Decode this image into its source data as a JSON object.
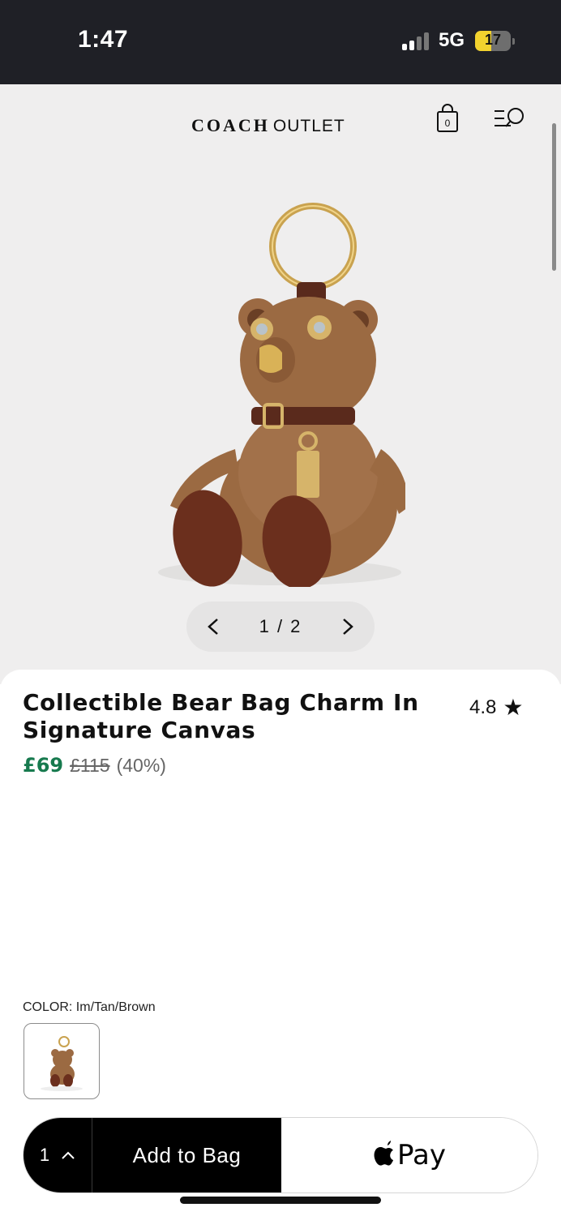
{
  "status_bar": {
    "time": "1:47",
    "network": "5G",
    "battery": "17"
  },
  "header": {
    "brand": "COACH",
    "brand_sub": "OUTLET",
    "bag_count": "0",
    "icons": [
      "shopping-bag-icon",
      "menu-search-icon"
    ]
  },
  "gallery": {
    "position": "1 / 2",
    "prev_icon": "chevron-left-icon",
    "next_icon": "chevron-right-icon"
  },
  "product": {
    "title": "Collectible Bear Bag Charm In Signature Canvas",
    "rating": "4.8",
    "rating_icon": "star-icon",
    "price_sale": "£69",
    "price_original": "£115",
    "discount": "(40%)",
    "color_label": "COLOR: Im/Tan/Brown"
  },
  "actions": {
    "quantity": "1",
    "add_to_bag": "Add to Bag",
    "apple_pay": "Pay"
  },
  "colors": {
    "sale": "#177a4e",
    "dark": "#000000",
    "status_bar": "#1f2026",
    "battery": "#f2d22e"
  }
}
